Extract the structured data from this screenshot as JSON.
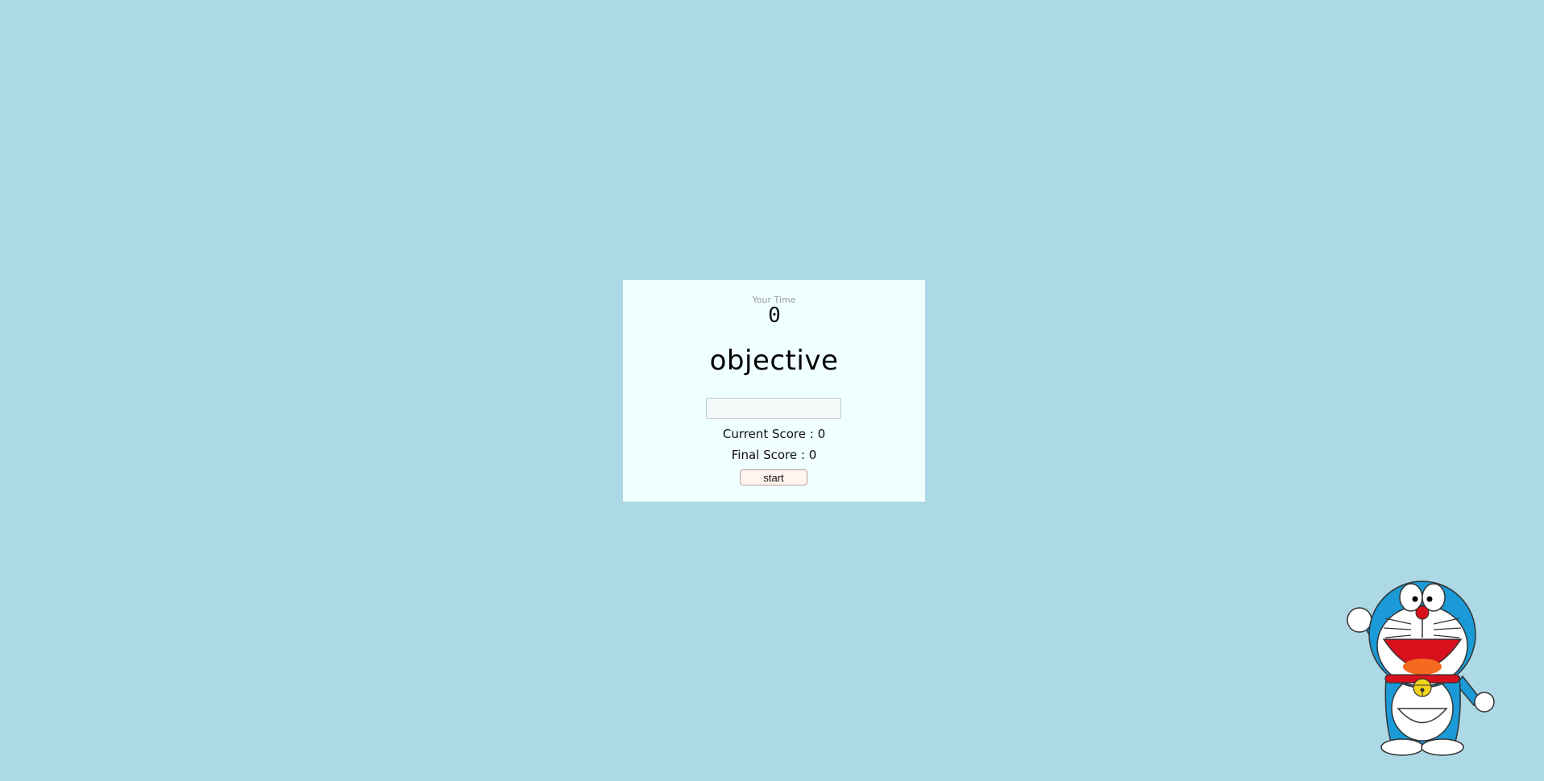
{
  "game": {
    "time_label": "Your Time",
    "time_value": "0",
    "current_word": "objective",
    "input_value": "",
    "current_score_text": "Current Score : 0",
    "final_score_text": "Final Score : 0",
    "start_label": "start"
  },
  "colors": {
    "background": "#add8e6",
    "card": "#f0ffff"
  },
  "mascot": {
    "icon": "doraemon-mascot-icon"
  }
}
